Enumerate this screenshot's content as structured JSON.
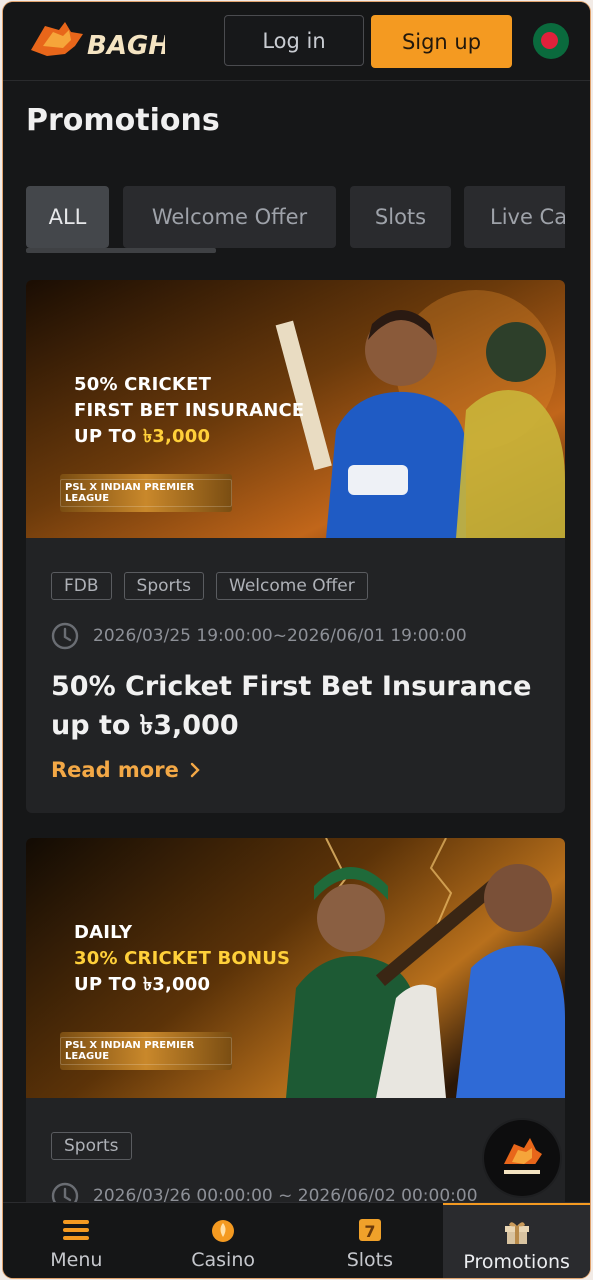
{
  "header": {
    "logo_text": "BAGH",
    "login_label": "Log in",
    "signup_label": "Sign up",
    "flag_icon": "bangladesh-flag-icon"
  },
  "page": {
    "title": "Promotions"
  },
  "tabs": [
    {
      "label": "ALL",
      "active": true
    },
    {
      "label": "Welcome Offer",
      "active": false
    },
    {
      "label": "Slots",
      "active": false
    },
    {
      "label": "Live Ca",
      "active": false
    }
  ],
  "promotions": [
    {
      "banner": {
        "line1": "50% CRICKET",
        "line2": "FIRST BET INSURANCE",
        "line3_prefix": "UP TO ",
        "line3_highlight": "৳3,000",
        "leagues": "PSL X INDIAN PREMIER LEAGUE"
      },
      "tags": [
        "FDB",
        "Sports",
        "Welcome Offer"
      ],
      "datetime": "2026/03/25 19:00:00~2026/06/01 19:00:00",
      "title": "50% Cricket First Bet Insurance up to ৳3,000",
      "read_more": "Read more"
    },
    {
      "banner": {
        "line1": "DAILY",
        "line2": "30% CRICKET BONUS",
        "line3_prefix": "UP TO ",
        "line3_highlight": "৳3,000",
        "leagues": "PSL X INDIAN PREMIER LEAGUE"
      },
      "tags": [
        "Sports"
      ],
      "datetime": "2026/03/26 00:00:00 ~ 2026/06/02 00:00:00"
    }
  ],
  "bottom_nav": [
    {
      "label": "Menu",
      "icon": "menu-icon"
    },
    {
      "label": "Casino",
      "icon": "casino-icon"
    },
    {
      "label": "Slots",
      "icon": "slots-icon"
    },
    {
      "label": "Promotions",
      "icon": "gift-icon",
      "active": true
    }
  ],
  "colors": {
    "accent": "#f49a21",
    "background": "#161718",
    "card": "#222325",
    "link": "#f3a846"
  }
}
